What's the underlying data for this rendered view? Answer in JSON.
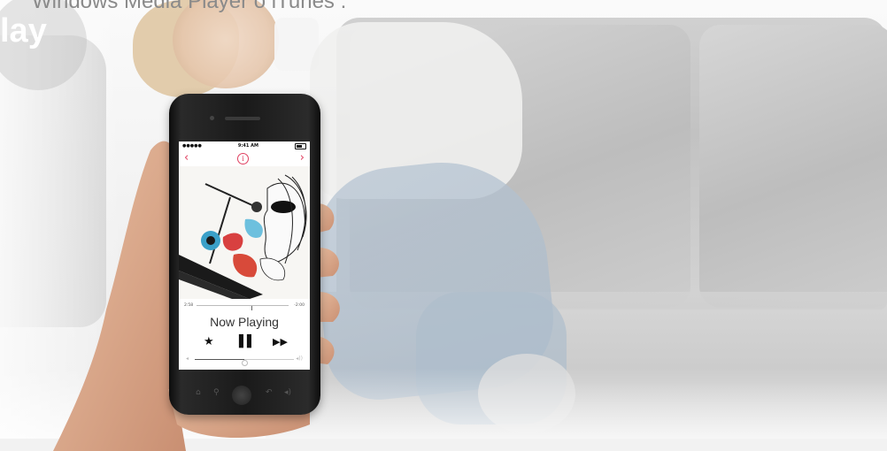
{
  "overlay": {
    "caption": "Windows Media Player o iTunes .",
    "badge": "lay"
  },
  "status_bar": {
    "signal": "●●●●●",
    "wifi": "⌘",
    "time": "9:41 AM"
  },
  "nav": {
    "back_icon": "‹",
    "info_icon": "i",
    "next_icon": "›"
  },
  "player": {
    "elapsed": "2:58",
    "remaining": "-2:00",
    "title": "Now Playing",
    "progress": 0.6,
    "volume": 0.5,
    "star_icon": "★",
    "pause_icon": "▌▌",
    "forward_icon": "▶▶",
    "vol_low_icon": "◂",
    "vol_high_icon": "◂))"
  },
  "hardware": {
    "home_icon": "⌂",
    "search_icon": "⚲",
    "back_icon": "↶",
    "volume_icon": "◂)"
  },
  "colors": {
    "accent": "#e04060",
    "phone_body": "#1a1a1a"
  }
}
